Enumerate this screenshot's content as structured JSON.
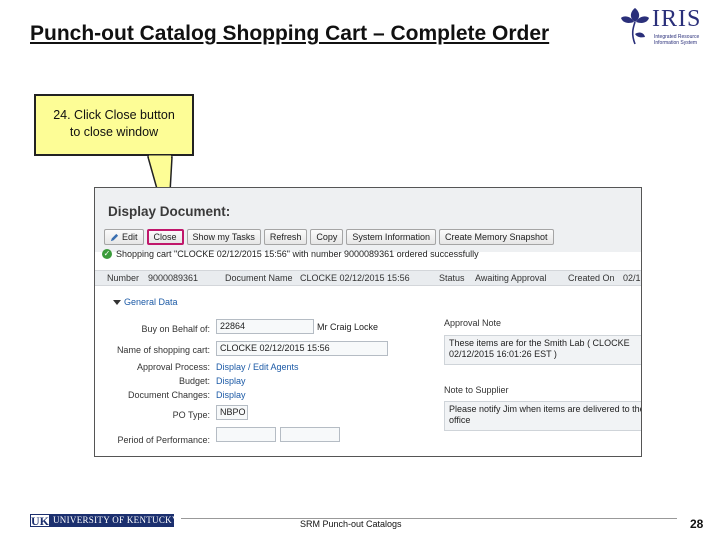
{
  "slide": {
    "title": "Punch-out Catalog Shopping Cart – Complete Order",
    "logo_text": "IRIS",
    "logo_tagline": "Integrated Resource\nInformation System",
    "page_number": "28",
    "footer": "SRM Punch-out Catalogs",
    "uk_logo_mark": "UK",
    "uk_logo_text": "UNIVERSITY OF KENTUCKY"
  },
  "callout": {
    "line1": "24. Click Close button",
    "line2": "to close window"
  },
  "screen": {
    "title": "Display Document:",
    "toolbar": {
      "edit": "Edit",
      "close": "Close",
      "show_tasks": "Show my Tasks",
      "refresh": "Refresh",
      "copy": "Copy",
      "system_info": "System Information",
      "memory_snapshot": "Create Memory Snapshot"
    },
    "message": "Shopping cart \"CLOCKE 02/12/2015 15:56\" with number 9000089361 ordered successfully",
    "status_bar": {
      "number_label": "Number",
      "number_value": "9000089361",
      "doc_name_label": "Document Name",
      "doc_name_value": "CLOCKE 02/12/2015 15:56",
      "status_label": "Status",
      "status_value": "Awaiting Approval",
      "created_label": "Created On",
      "created_value": "02/1"
    },
    "general_data": {
      "section": "General Data",
      "buy_on_behalf_label": "Buy on Behalf of:",
      "buy_on_behalf_value": "22864",
      "buy_on_behalf_name": "Mr Craig Locke",
      "cart_name_label": "Name of shopping cart:",
      "cart_name_value": "CLOCKE 02/12/2015 15:56",
      "approval_process_label": "Approval Process:",
      "approval_process_value": "Display / Edit Agents",
      "budget_label": "Budget:",
      "budget_value": "Display",
      "doc_changes_label": "Document Changes:",
      "doc_changes_value": "Display",
      "po_type_label": "PO Type:",
      "po_type_value": "NBPO",
      "period_label": "Period of Performance:"
    },
    "notes": {
      "approval_note_label": "Approval Note",
      "approval_note_text": "These items are for the Smith Lab ( CLOCKE 02/12/2015 16:01:26 EST )",
      "supplier_note_label": "Note to Supplier",
      "supplier_note_text": "Please notify Jim when items are delivered to the office"
    }
  },
  "colors": {
    "callout_bg": "#fdfd96",
    "highlight": "#c0176b",
    "link": "#1c5aa6",
    "uk_blue": "#1b2f6e"
  }
}
